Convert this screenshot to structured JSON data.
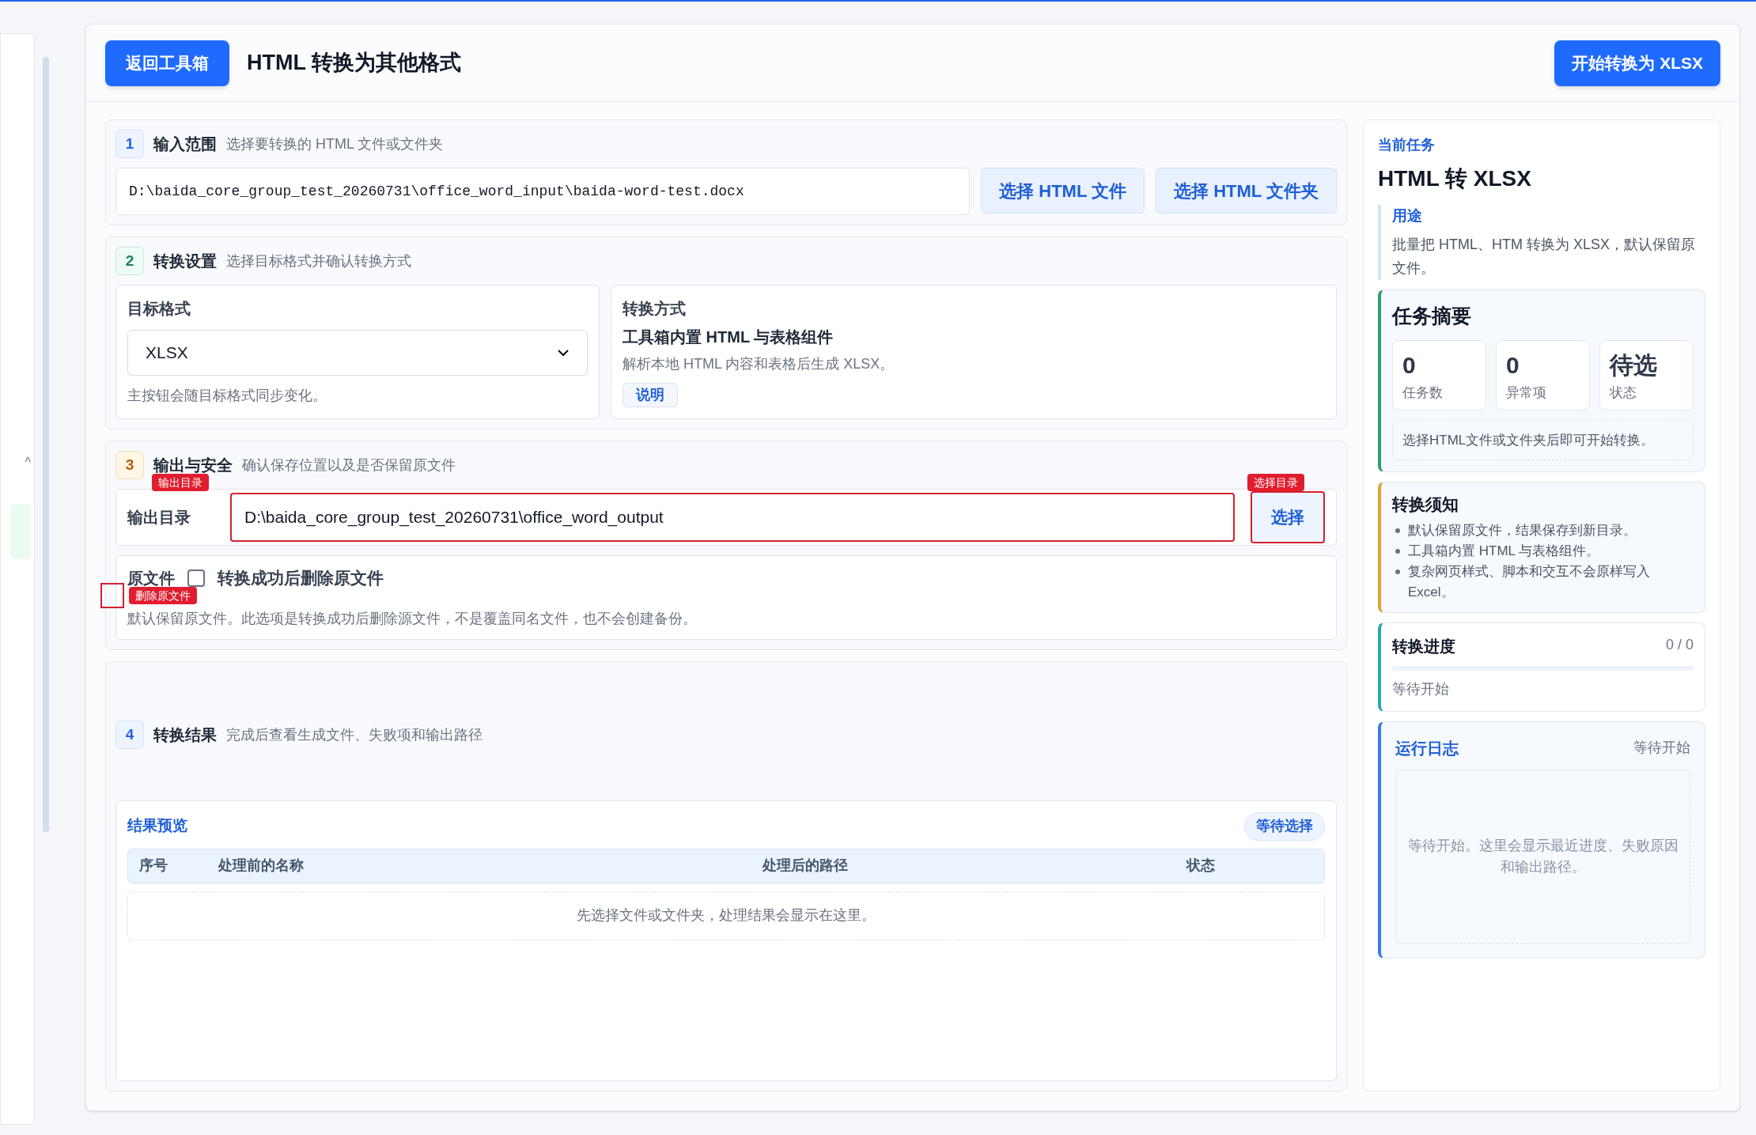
{
  "left_panel": {
    "chevron": "^"
  },
  "header": {
    "back_button": "返回工具箱",
    "title": "HTML 转换为其他格式",
    "start_button": "开始转换为 XLSX"
  },
  "section_input": {
    "number": "1",
    "title": "输入范围",
    "hint": "选择要转换的 HTML 文件或文件夹",
    "path": "D:\\baida_core_group_test_20260731\\office_word_input\\baida-word-test.docx",
    "buttons": [
      "选择 HTML 文件",
      "选择 HTML 文件夹"
    ]
  },
  "section_settings": {
    "number": "2",
    "title": "转换设置",
    "hint": "选择目标格式并确认转换方式",
    "target": {
      "label": "目标格式",
      "value": "XLSX",
      "note": "主按钮会随目标格式同步变化。"
    },
    "method": {
      "label": "转换方式",
      "name": "工具箱内置 HTML 与表格组件",
      "description": "解析本地 HTML 内容和表格后生成 XLSX。",
      "button": "说明"
    }
  },
  "section_output": {
    "number": "3",
    "title": "输出与安全",
    "hint": "确认保存位置以及是否保留原文件",
    "output_dir": {
      "label": "输出目录",
      "value": "D:\\baida_core_group_test_20260731\\office_word_output",
      "button": "选择",
      "tag": "输出目录",
      "button_tag": "选择目录"
    },
    "delete_source": {
      "label": "原文件",
      "option": "转换成功后删除原文件",
      "checked": false,
      "tag": "删除原文件",
      "note": "默认保留原文件。此选项是转换成功后删除源文件，不是覆盖同名文件，也不会创建备份。"
    }
  },
  "section_result": {
    "number": "4",
    "title": "转换结果",
    "hint": "完成后查看生成文件、失败项和输出路径",
    "preview": {
      "title": "结果预览",
      "badge": "等待选择",
      "columns": [
        "序号",
        "处理前的名称",
        "处理后的路径",
        "状态"
      ],
      "empty": "先选择文件或文件夹，处理结果会显示在这里。"
    }
  },
  "sidebar": {
    "eyebrow": "当前任务",
    "title": "HTML 转 XLSX",
    "usage_label": "用途",
    "usage": "批量把 HTML、HTM 转换为 XLSX，默认保留原文件。",
    "summary": {
      "title": "任务摘要",
      "stats": [
        {
          "value": "0",
          "label": "任务数"
        },
        {
          "value": "0",
          "label": "异常项"
        },
        {
          "value": "待选",
          "label": "状态"
        }
      ],
      "note": "选择HTML文件或文件夹后即可开始转换。"
    },
    "notice": {
      "title": "转换须知",
      "items": [
        "默认保留原文件，结果保存到新目录。",
        "工具箱内置 HTML 与表格组件。",
        "复杂网页样式、脚本和交互不会原样写入Excel。"
      ]
    },
    "progress": {
      "title": "转换进度",
      "count": "0 / 0",
      "level": 0,
      "status": "等待开始"
    },
    "log": {
      "title": "运行日志",
      "status": "等待开始",
      "empty": "等待开始。这里会显示最近进度、失败原因和输出路径。"
    }
  }
}
